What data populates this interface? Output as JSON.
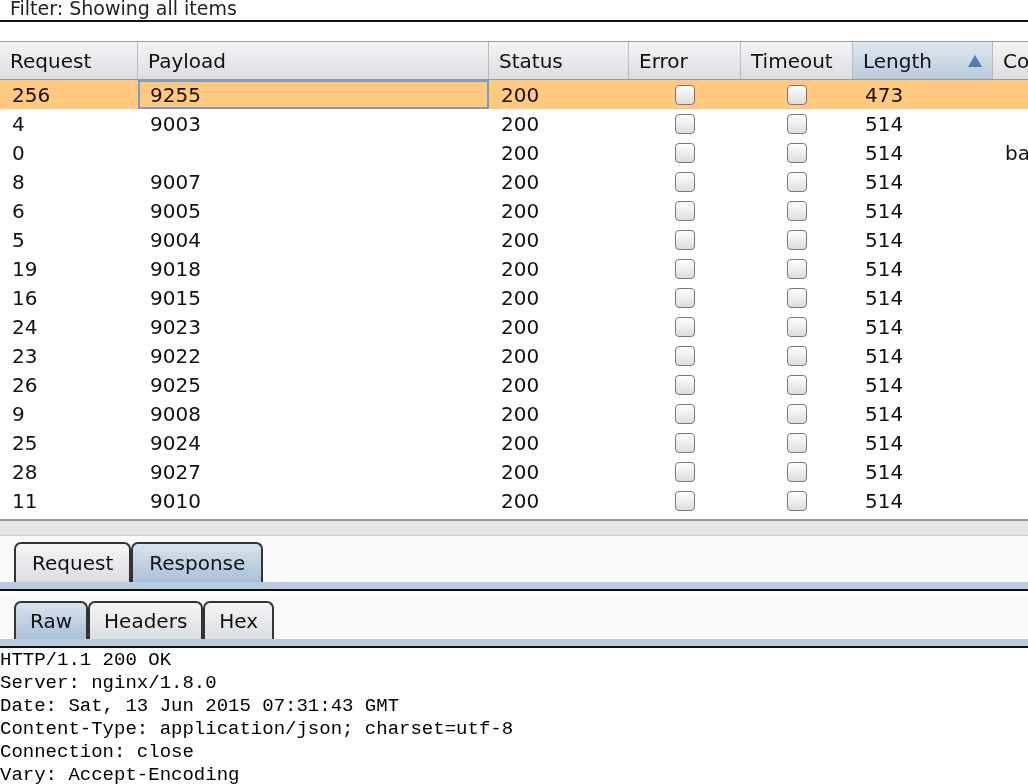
{
  "filter": {
    "text": "Filter: Showing all items"
  },
  "table": {
    "columns": [
      {
        "label": "Request",
        "sorted": false
      },
      {
        "label": "Payload",
        "sorted": false
      },
      {
        "label": "Status",
        "sorted": false
      },
      {
        "label": "Error",
        "sorted": false
      },
      {
        "label": "Timeout",
        "sorted": false
      },
      {
        "label": "Length",
        "sorted": true
      },
      {
        "label": "Co",
        "sorted": false
      }
    ],
    "rows": [
      {
        "request": "256",
        "payload": "9255",
        "status": "200",
        "error": false,
        "timeout": false,
        "length": "473",
        "selected": true
      },
      {
        "request": "4",
        "payload": "9003",
        "status": "200",
        "error": false,
        "timeout": false,
        "length": "514",
        "selected": false
      },
      {
        "request": "0",
        "status": "200",
        "error": false,
        "timeout": false,
        "length": "514",
        "column_7": "ba",
        "selected": false
      },
      {
        "request": "8",
        "payload": "9007",
        "status": "200",
        "error": false,
        "timeout": false,
        "length": "514",
        "selected": false
      },
      {
        "request": "6",
        "payload": "9005",
        "status": "200",
        "error": false,
        "timeout": false,
        "length": "514",
        "selected": false
      },
      {
        "request": "5",
        "payload": "9004",
        "status": "200",
        "error": false,
        "timeout": false,
        "length": "514",
        "selected": false
      },
      {
        "request": "19",
        "payload": "9018",
        "status": "200",
        "error": false,
        "timeout": false,
        "length": "514",
        "selected": false
      },
      {
        "request": "16",
        "payload": "9015",
        "status": "200",
        "error": false,
        "timeout": false,
        "length": "514",
        "selected": false
      },
      {
        "request": "24",
        "payload": "9023",
        "status": "200",
        "error": false,
        "timeout": false,
        "length": "514",
        "selected": false
      },
      {
        "request": "23",
        "payload": "9022",
        "status": "200",
        "error": false,
        "timeout": false,
        "length": "514",
        "selected": false
      },
      {
        "request": "26",
        "payload": "9025",
        "status": "200",
        "error": false,
        "timeout": false,
        "length": "514",
        "selected": false
      },
      {
        "request": "9",
        "payload": "9008",
        "status": "200",
        "error": false,
        "timeout": false,
        "length": "514",
        "selected": false
      },
      {
        "request": "25",
        "payload": "9024",
        "status": "200",
        "error": false,
        "timeout": false,
        "length": "514",
        "selected": false
      },
      {
        "request": "28",
        "payload": "9027",
        "status": "200",
        "error": false,
        "timeout": false,
        "length": "514",
        "selected": false
      },
      {
        "request": "11",
        "payload": "9010",
        "status": "200",
        "error": false,
        "timeout": false,
        "length": "514",
        "selected": false
      }
    ]
  },
  "message_tabs": [
    {
      "label": "Request",
      "selected": false
    },
    {
      "label": "Response",
      "selected": true
    }
  ],
  "view_tabs": [
    {
      "label": "Raw",
      "selected": true
    },
    {
      "label": "Headers",
      "selected": false
    },
    {
      "label": "Hex",
      "selected": false
    }
  ],
  "response_lines": [
    "HTTP/1.1 200 OK",
    "Server: nginx/1.8.0",
    "Date: Sat, 13 Jun 2015 07:31:43 GMT",
    "Content-Type: application/json; charset=utf-8",
    "Connection: close",
    "Vary: Accept-Encoding"
  ]
}
